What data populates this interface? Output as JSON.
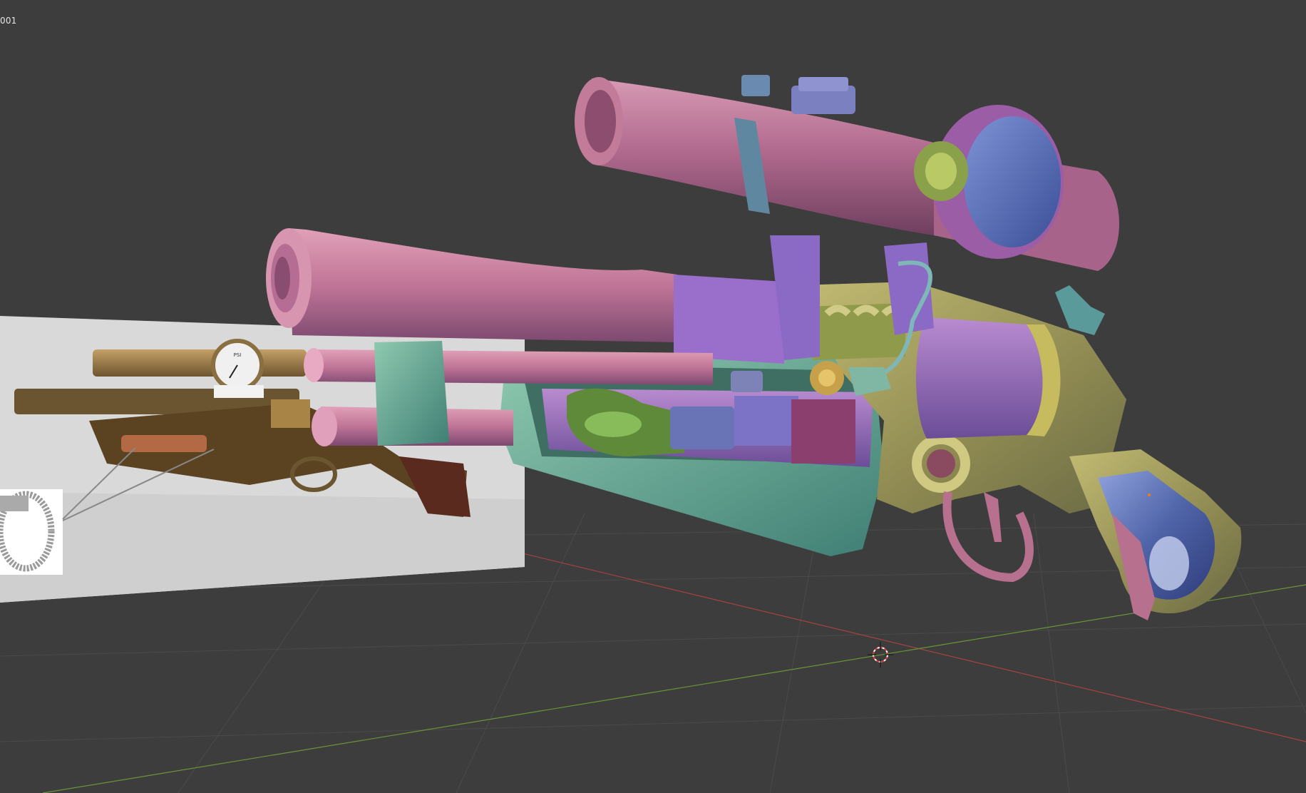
{
  "viewport": {
    "object_label": "001",
    "background": "#3d3d3d",
    "grid_color": "#4a4a4a",
    "axis_x_color": "#b04444",
    "axis_y_color": "#6f9a3a"
  },
  "model": {
    "scope_color": "#b46f93",
    "barrel_color": "#c57a9a",
    "stock_color": "#5f9c86",
    "frame_color": "#a5a05a",
    "grip_color": "#4d6aa6"
  },
  "reference_image": {
    "gauge_label": "PSI"
  },
  "icons": {
    "cursor": "3d-cursor-icon",
    "clamp": "hose-clamp-icon"
  }
}
